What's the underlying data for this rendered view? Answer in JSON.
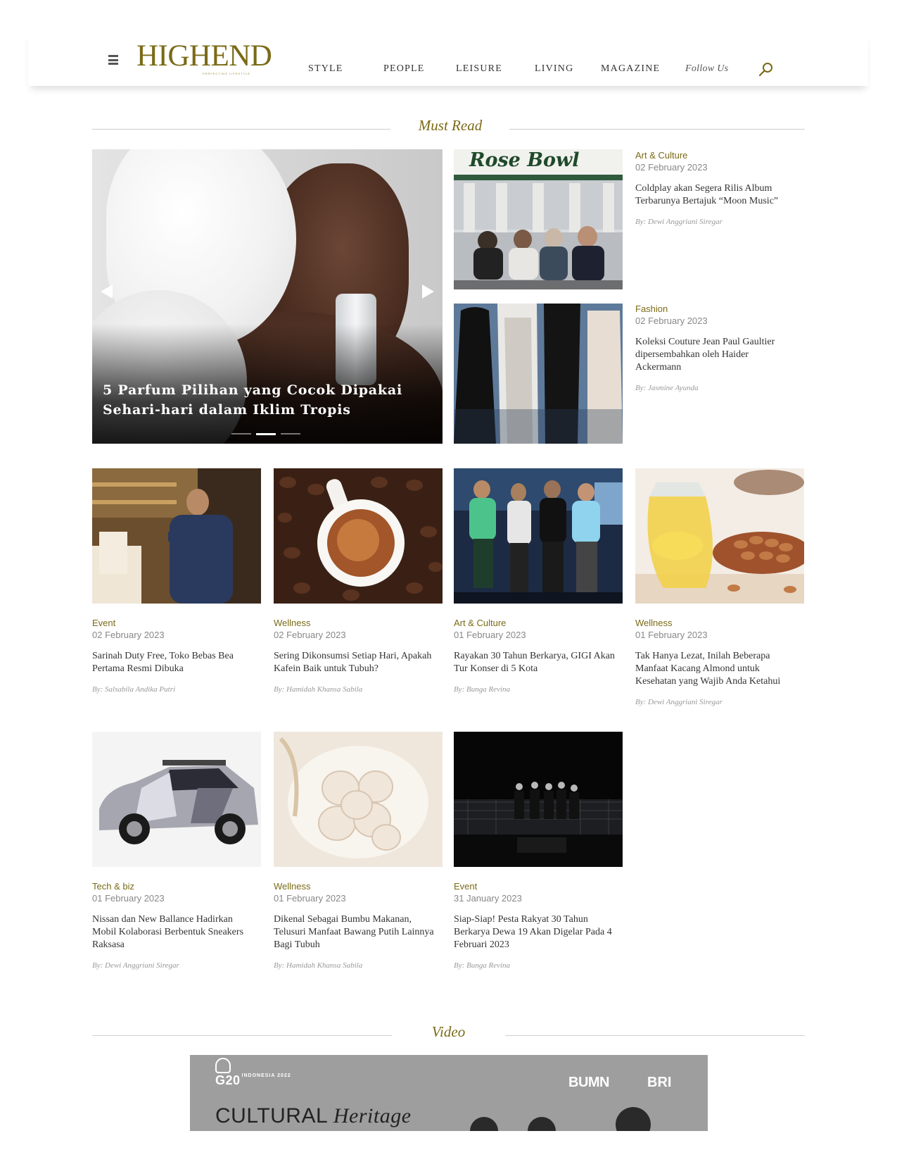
{
  "header": {
    "logo": "HIGHEND",
    "logo_tagline": "PERFECTING LIFESTYLE",
    "nav": [
      "STYLE",
      "PEOPLE",
      "LEISURE",
      "LIVING",
      "MAGAZINE"
    ],
    "follow_label": "Follow Us",
    "accent_color": "#7a6a16"
  },
  "must_read": {
    "heading": "Must Read",
    "hero": {
      "title": "5 Parfum Pilihan yang Cocok Dipakai Sehari-hari dalam Iklim Tropis",
      "slide_count": 3,
      "active_slide": 2
    },
    "side_articles": [
      {
        "category": "Art & Culture",
        "date": "02 February 2023",
        "title": "Coldplay akan Segera Rilis Album Terbarunya Bertajuk “Moon Music”",
        "author": "By: Dewi Anggriani Siregar",
        "image_sign": "Rose Bowl"
      },
      {
        "category": "Fashion",
        "date": "02 February 2023",
        "title": "Koleksi Couture Jean Paul Gaultier dipersembahkan oleh Haider Ackermann",
        "author": "By: Jasmine Ayunda"
      }
    ]
  },
  "grid": [
    {
      "category": "Event",
      "date": "02 February 2023",
      "title": "Sarinah Duty Free, Toko Bebas Bea Pertama Resmi Dibuka",
      "author": "By: Salsabila Andika Putri"
    },
    {
      "category": "Wellness",
      "date": "02 February 2023",
      "title": "Sering Dikonsumsi Setiap Hari, Apakah Kafein Baik untuk Tubuh?",
      "author": "By: Hamidah Khansa Sabila"
    },
    {
      "category": "Art & Culture",
      "date": "01 February 2023",
      "title": "Rayakan 30 Tahun Berkarya, GIGI Akan Tur Konser di 5 Kota",
      "author": "By: Bunga Revina"
    },
    {
      "category": "Wellness",
      "date": "01 February 2023",
      "title": "Tak Hanya Lezat, Inilah Beberapa Manfaat Kacang Almond untuk Kesehatan yang Wajib Anda Ketahui",
      "author": "By: Dewi Anggriani Siregar"
    },
    {
      "category": "Tech & biz",
      "date": "01 February 2023",
      "title": "Nissan dan New Ballance Hadirkan Mobil Kolaborasi Berbentuk Sneakers Raksasa",
      "author": "By: Dewi Anggriani Siregar"
    },
    {
      "category": "Wellness",
      "date": "01 February 2023",
      "title": "Dikenal Sebagai Bumbu Makanan, Telusuri Manfaat Bawang Putih Lainnya Bagi Tubuh",
      "author": "By: Hamidah Khansa Sabila"
    },
    {
      "category": "Event",
      "date": "31 January 2023",
      "title": "Siap-Siap! Pesta Rakyat 30 Tahun Berkarya Dewa 19 Akan Digelar Pada 4 Februari 2023",
      "author": "By: Bunga Revina"
    }
  ],
  "video": {
    "heading": "Video",
    "logo_left": "G20",
    "logo_left_sub": "INDONESIA 2022",
    "logo_bumn": "BUMN",
    "logo_bri": "BRI",
    "caption_word1": "CULTURAL",
    "caption_word2": "Heritage"
  },
  "icons": [
    "hamburger-menu-icon",
    "search-icon",
    "arrow-left-icon",
    "arrow-right-icon"
  ]
}
